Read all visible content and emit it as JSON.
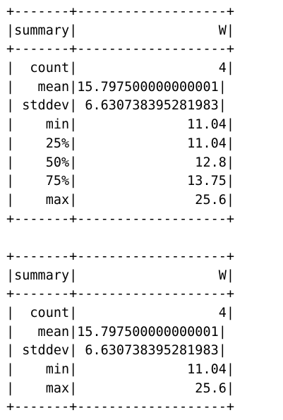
{
  "tables": [
    {
      "border": "+-------+-------------------+",
      "header": "|summary|                  W|",
      "rows": [
        "|  count|                  4|",
        "|   mean|15.797500000000001|",
        "| stddev| 6.630738395281983|",
        "|    min|              11.04|",
        "|    25%|              11.04|",
        "|    50%|               12.8|",
        "|    75%|              13.75|",
        "|    max|               25.6|"
      ]
    },
    {
      "border": "+-------+-------------------+",
      "header": "|summary|                  W|",
      "rows": [
        "|  count|                  4|",
        "|   mean|15.797500000000001|",
        "| stddev| 6.630738395281983|",
        "|    min|              11.04|",
        "|    max|               25.6|"
      ]
    }
  ]
}
